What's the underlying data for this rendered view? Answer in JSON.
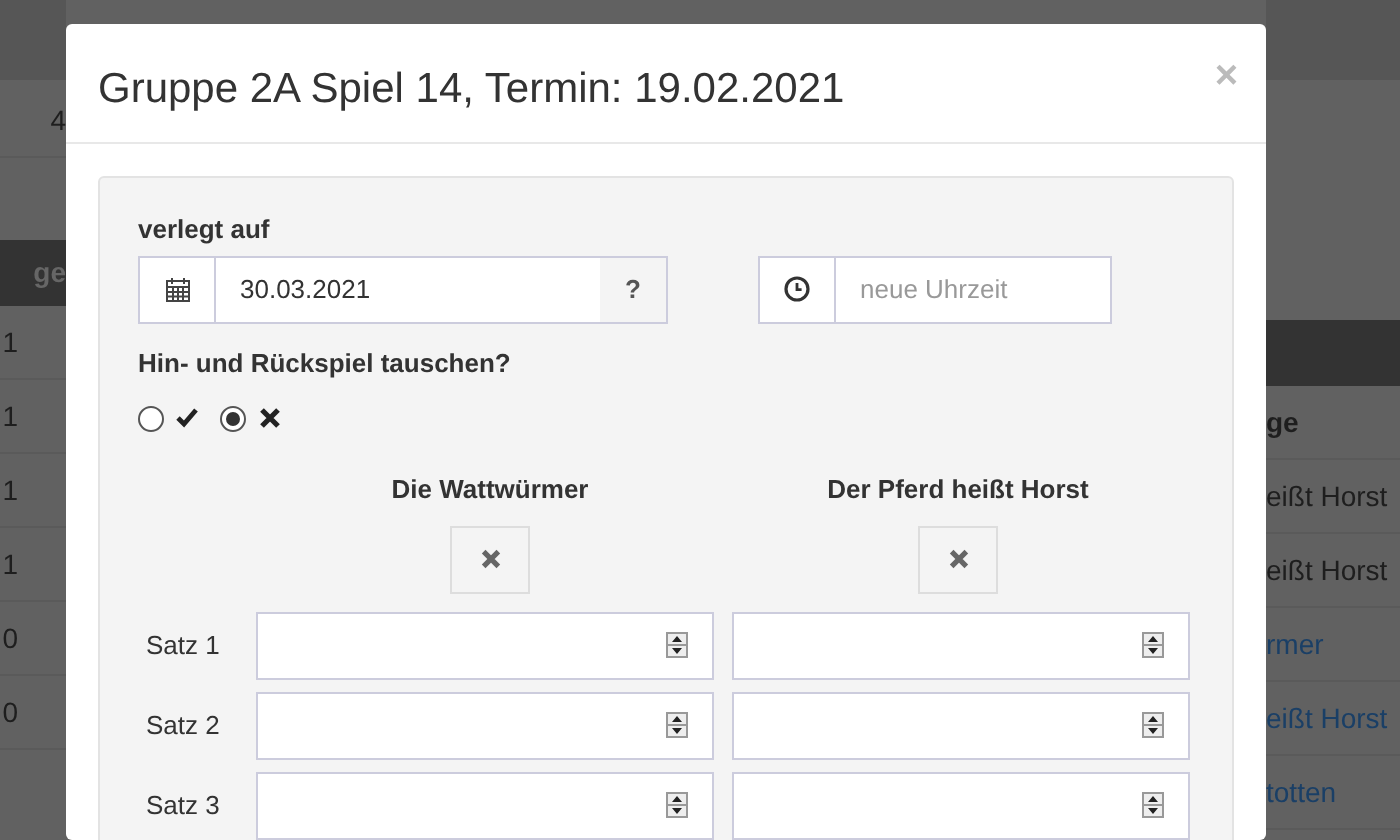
{
  "background": {
    "top_value": "4",
    "left_table": {
      "header": "ge",
      "cells": [
        "1",
        "1",
        "1",
        "1",
        "0",
        "0"
      ]
    },
    "right_table": {
      "header": "ge",
      "cells": [
        {
          "text": "eißt Horst",
          "link": false
        },
        {
          "text": "eißt Horst",
          "link": false
        },
        {
          "text": "rmer",
          "link": true
        },
        {
          "text": "eißt Horst",
          "link": true
        },
        {
          "text": "totten",
          "link": true
        }
      ]
    }
  },
  "modal": {
    "title": "Gruppe 2A Spiel 14, Termin: 19.02.2021",
    "close": "×",
    "date_label": "verlegt auf",
    "date_value": "30.03.2021",
    "help": "?",
    "time_placeholder": "neue Uhrzeit",
    "swap_label": "Hin- und Rückspiel tauschen?",
    "swap_options": [
      {
        "kind": "check",
        "selected": false
      },
      {
        "kind": "cross",
        "selected": true
      }
    ],
    "teams": [
      {
        "name": "Die Wattwürmer"
      },
      {
        "name": "Der Pferd heißt Horst"
      }
    ],
    "sets": [
      {
        "label": "Satz 1"
      },
      {
        "label": "Satz 2"
      },
      {
        "label": "Satz 3"
      }
    ]
  }
}
